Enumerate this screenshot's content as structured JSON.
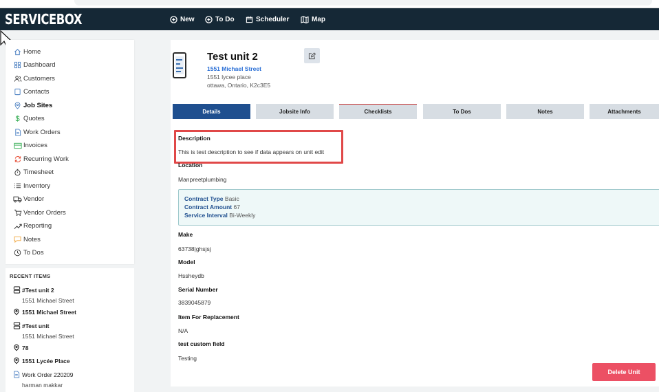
{
  "app": {
    "logo": "SERVICEBOX",
    "nav": [
      {
        "label": "New",
        "icon": "plus-circle-icon"
      },
      {
        "label": "To Do",
        "icon": "plus-circle-icon"
      },
      {
        "label": "Scheduler",
        "icon": "calendar-icon"
      },
      {
        "label": "Map",
        "icon": "map-icon"
      }
    ]
  },
  "sidebar": {
    "items": [
      {
        "label": "Home",
        "icon": "home-icon"
      },
      {
        "label": "Dashboard",
        "icon": "dashboard-icon"
      },
      {
        "label": "Customers",
        "icon": "users-icon"
      },
      {
        "label": "Contacts",
        "icon": "contacts-icon"
      },
      {
        "label": "Job Sites",
        "icon": "location-pin-icon"
      },
      {
        "label": "Quotes",
        "icon": "dollar-icon"
      },
      {
        "label": "Work Orders",
        "icon": "document-icon"
      },
      {
        "label": "Invoices",
        "icon": "invoice-icon"
      },
      {
        "label": "Recurring Work",
        "icon": "recurring-icon"
      },
      {
        "label": "Timesheet",
        "icon": "stopwatch-icon"
      },
      {
        "label": "Inventory",
        "icon": "list-icon"
      },
      {
        "label": "Vendor",
        "icon": "truck-icon"
      },
      {
        "label": "Vendor Orders",
        "icon": "cart-icon"
      },
      {
        "label": "Reporting",
        "icon": "trend-icon"
      },
      {
        "label": "Notes",
        "icon": "note-icon"
      },
      {
        "label": "To Dos",
        "icon": "clock-icon"
      }
    ]
  },
  "recent": {
    "title": "RECENT ITEMS",
    "items": [
      {
        "label": "#Test unit 2",
        "sub": "1551 Michael Street",
        "icon": "server-icon"
      },
      {
        "label": "1551 Michael Street",
        "sub": "",
        "icon": "location-pin-icon"
      },
      {
        "label": "#Test unit",
        "sub": "1551 Michael Street",
        "icon": "server-icon"
      },
      {
        "label": "78",
        "sub": "",
        "icon": "location-pin-icon"
      },
      {
        "label": "1551 Lycée Place",
        "sub": "",
        "icon": "location-pin-icon"
      },
      {
        "label": "Work Order 220209",
        "sub": "harman makkar",
        "icon": "document-icon"
      }
    ]
  },
  "unit": {
    "title": "Test unit 2",
    "address_link": "1551 Michael Street",
    "address_line1": "1551 lycee place",
    "address_line2": "ottawa, Ontario, K2c3E5"
  },
  "tabs": [
    "Details",
    "Jobsite Info",
    "Checklists",
    "To Dos",
    "Notes",
    "Attachments"
  ],
  "details": {
    "description_label": "Description",
    "description_value": "This is test description to see if data appears on unit edit",
    "location_label": "Location",
    "location_value": "Manpreetplumbing",
    "contract": {
      "type_label": "Contract Type",
      "type_value": "Basic",
      "amount_label": "Contract Amount",
      "amount_value": "67",
      "interval_label": "Service Interval",
      "interval_value": "Bi-Weekly"
    },
    "make_label": "Make",
    "make_value": "63738|ghsjsj",
    "model_label": "Model",
    "model_value": "Hssheydb",
    "serial_label": "Serial Number",
    "serial_value": "3839045879",
    "replacement_label": "Item For Replacement",
    "replacement_value": "N/A",
    "custom_label": "test custom field",
    "custom_value": "Testing"
  },
  "actions": {
    "delete_label": "Delete Unit"
  },
  "colors": {
    "topbar": "#152836",
    "active_tab": "#1f4f8f",
    "delete": "#ec5064",
    "highlight": "#e04848",
    "link": "#2a6fd6"
  }
}
